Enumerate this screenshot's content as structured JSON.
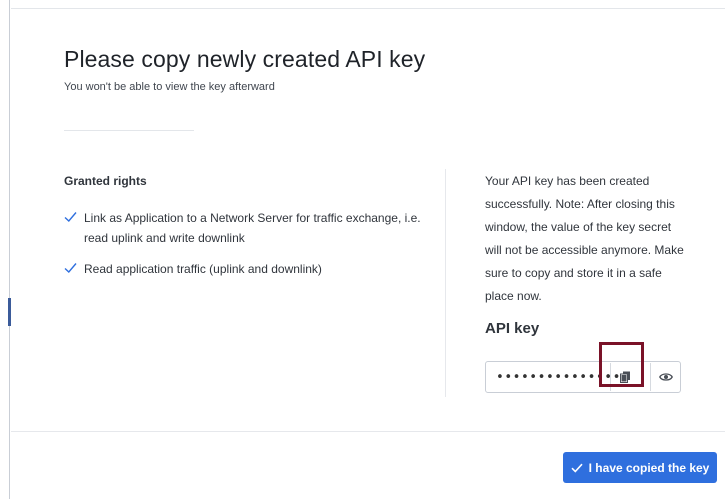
{
  "dialog": {
    "title": "Please copy newly created API key",
    "subtitle": "You won't be able to view the key afterward"
  },
  "rights": {
    "heading": "Granted rights",
    "items": [
      {
        "label": "Link as Application to a Network Server for traffic exchange, i.e. read uplink and write downlink",
        "icon": "check-icon"
      },
      {
        "label": "Read application traffic (uplink and downlink)",
        "icon": "check-icon"
      }
    ]
  },
  "notice": {
    "text": "Your API key has been created successfully. Note: After closing this window, the value of the key secret will not be accessible anymore. Make sure to copy and store it in a safe place now."
  },
  "api_key": {
    "label": "API key",
    "masked_value": "••••••••••••••••",
    "copy_icon": "copy-icon",
    "reveal_icon": "eye-icon"
  },
  "footer": {
    "confirm_label": "I have copied the key",
    "confirm_icon": "check-icon"
  },
  "colors": {
    "primary": "#2f6fde",
    "check": "#2f6fde",
    "highlight": "#7a1228"
  }
}
